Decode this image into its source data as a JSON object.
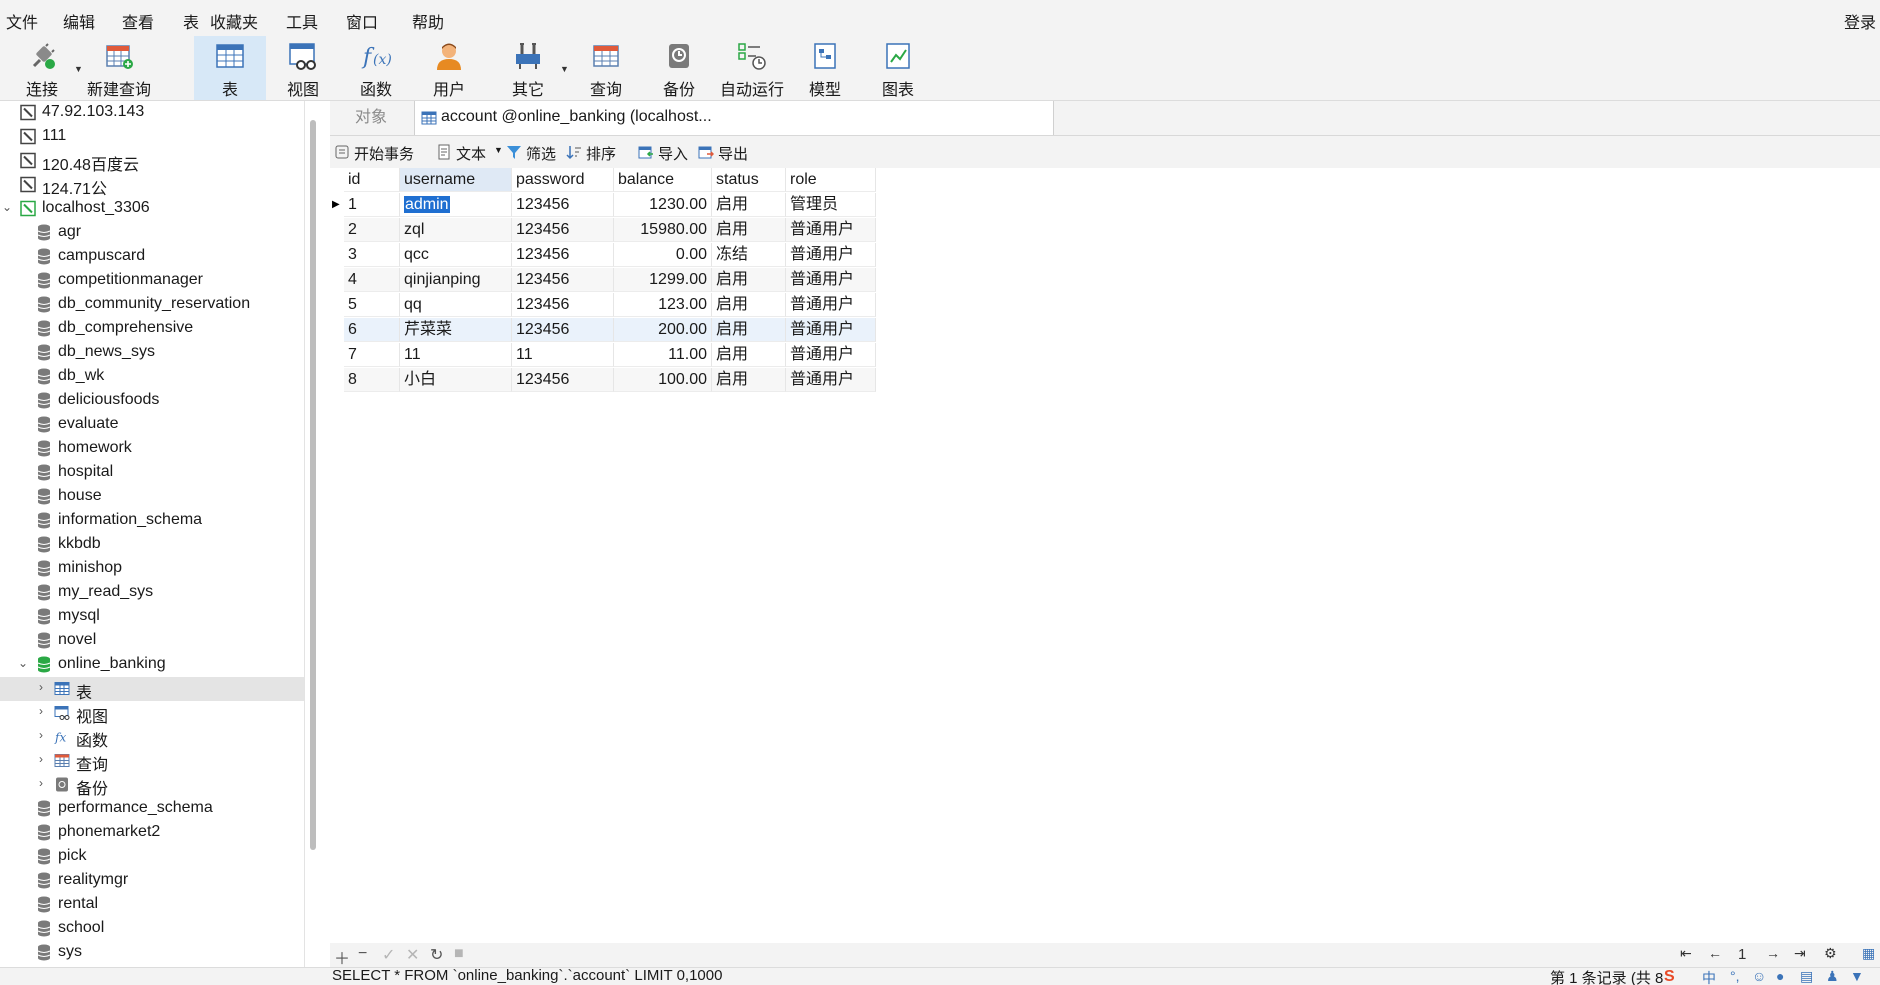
{
  "menu": {
    "file": "文件",
    "edit": "编辑",
    "view": "查看",
    "table": "表",
    "favorites": "收藏夹",
    "tools": "工具",
    "window": "窗口",
    "help": "帮助",
    "login": "登录"
  },
  "toolbar": {
    "connect": "连接",
    "new_query": "新建查询",
    "table": "表",
    "view": "视图",
    "function": "函数",
    "user": "用户",
    "other": "其它",
    "query": "查询",
    "backup": "备份",
    "autorun": "自动运行",
    "model": "模型",
    "chart": "图表"
  },
  "sidebar": {
    "connections": [
      "47.92.103.143",
      "111",
      "120.48百度云",
      "124.71公"
    ],
    "localhost": "localhost_3306",
    "databases_before": [
      "agr",
      "campuscard",
      "competitionmanager",
      "db_community_reservation",
      "db_comprehensive",
      "db_news_sys",
      "db_wk",
      "deliciousfoods",
      "evaluate",
      "homework",
      "hospital",
      "house",
      "information_schema",
      "kkbdb",
      "minishop",
      "my_read_sys",
      "mysql",
      "novel"
    ],
    "open_db": "online_banking",
    "open_db_children": [
      "表",
      "视图",
      "函数",
      "查询",
      "备份"
    ],
    "databases_after": [
      "performance_schema",
      "phonemarket2",
      "pick",
      "realitymgr",
      "rental",
      "school",
      "sys"
    ]
  },
  "tabs": {
    "objects": "对象",
    "active": "account @online_banking (localhost..."
  },
  "subtoolbar": {
    "begin_transaction": "开始事务",
    "text": "文本",
    "filter": "筛选",
    "sort": "排序",
    "import": "导入",
    "export": "导出"
  },
  "grid": {
    "columns": [
      "id",
      "username",
      "password",
      "balance",
      "status",
      "role"
    ],
    "rows": [
      [
        "1",
        "admin",
        "123456",
        "1230.00",
        "启用",
        "管理员"
      ],
      [
        "2",
        "zql",
        "123456",
        "15980.00",
        "启用",
        "普通用户"
      ],
      [
        "3",
        "qcc",
        "123456",
        "0.00",
        "冻结",
        "普通用户"
      ],
      [
        "4",
        "qinjianping",
        "123456",
        "1299.00",
        "启用",
        "普通用户"
      ],
      [
        "5",
        "qq",
        "123456",
        "123.00",
        "启用",
        "普通用户"
      ],
      [
        "6",
        "芹菜菜",
        "123456",
        "200.00",
        "启用",
        "普通用户"
      ],
      [
        "7",
        "11",
        "11",
        "11.00",
        "启用",
        "普通用户"
      ],
      [
        "8",
        "小白",
        "123456",
        "100.00",
        "启用",
        "普通用户"
      ]
    ]
  },
  "pager": {
    "page": "1"
  },
  "status": {
    "sql": "SELECT * FROM `online_banking`.`account` LIMIT 0,1000",
    "records": "第 1 条记录 (共 8"
  },
  "colors": {
    "accent": "#1f6fd1",
    "active_tab": "#d7e8f7",
    "db_green": "#2aa845"
  }
}
